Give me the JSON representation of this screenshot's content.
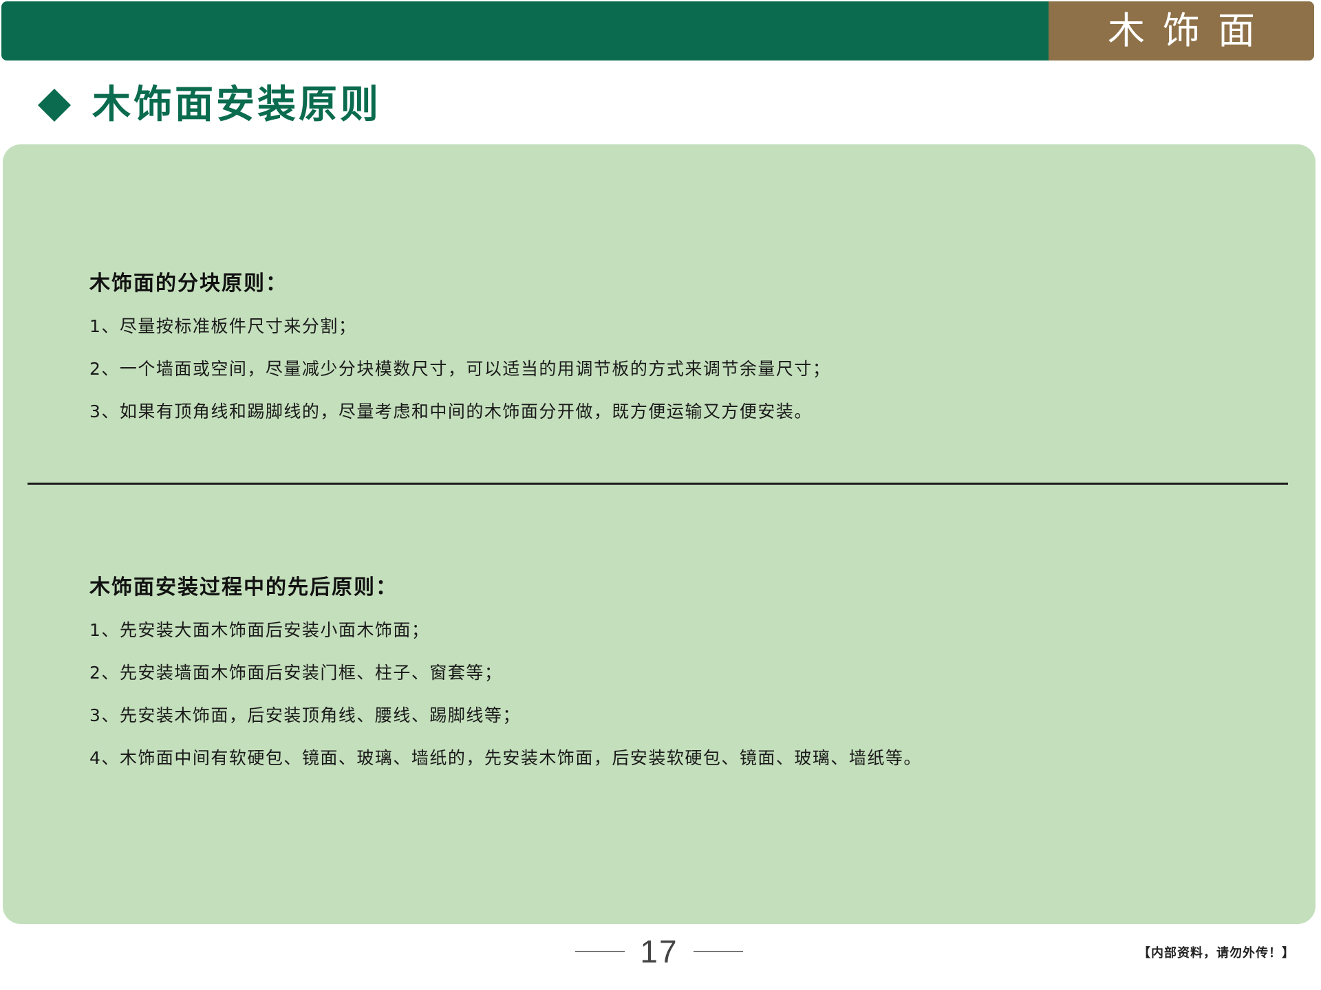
{
  "header": {
    "tab_label": "木饰面",
    "colors": {
      "bar": "#0a6b4e",
      "tab": "#8e7148",
      "panel": "#c4dfbc"
    }
  },
  "section": {
    "icon": "diamond-icon",
    "title": "木饰面安装原则"
  },
  "principles": [
    {
      "title": "木饰面的分块原则：",
      "items": [
        "1、尽量按标准板件尺寸来分割；",
        "2、一个墙面或空间，尽量减少分块模数尺寸，可以适当的用调节板的方式来调节余量尺寸；",
        "3、如果有顶角线和踢脚线的，尽量考虑和中间的木饰面分开做，既方便运输又方便安装。"
      ]
    },
    {
      "title": "木饰面安装过程中的先后原则：",
      "items": [
        "1、先安装大面木饰面后安装小面木饰面；",
        "2、先安装墙面木饰面后安装门框、柱子、窗套等；",
        "3、先安装木饰面，后安装顶角线、腰线、踢脚线等；",
        "4、木饰面中间有软硬包、镜面、玻璃、墙纸的，先安装木饰面，后安装软硬包、镜面、玻璃、墙纸等。"
      ]
    }
  ],
  "footer": {
    "page_number": "17",
    "note": "【内部资料，请勿外传！】"
  }
}
